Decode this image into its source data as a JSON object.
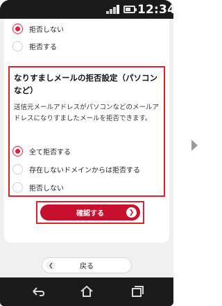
{
  "status_bar": {
    "time": "12:34",
    "icons": [
      "signal-icon",
      "battery-icon"
    ]
  },
  "top_options": [
    {
      "label": "拒否しない",
      "selected": true
    },
    {
      "label": "拒否する",
      "selected": false
    }
  ],
  "spoof_section": {
    "title": "なりすましメールの拒否設定（パソコンなど）",
    "description": "送信元メールアドレスがパソコンなどのメールアドレスになりすましたメールを拒否できます。",
    "options": [
      {
        "label": "全て拒否する",
        "selected": true
      },
      {
        "label": "存在しないドメインからは拒否する",
        "selected": false
      },
      {
        "label": "拒否しない",
        "selected": false
      }
    ]
  },
  "confirm_button": {
    "label": "確認する",
    "icon": "chevron-right-icon"
  },
  "back_button": {
    "label": "戻る",
    "icon": "chevron-left-icon"
  },
  "nav_bar": {
    "icons": [
      "back-icon",
      "home-icon",
      "recent-apps-icon"
    ]
  },
  "colors": {
    "accent": "#c8102e",
    "highlight_border": "#e0202e",
    "screen_background": "#f0f0f0",
    "phone_frame": "#1b1b1b"
  }
}
